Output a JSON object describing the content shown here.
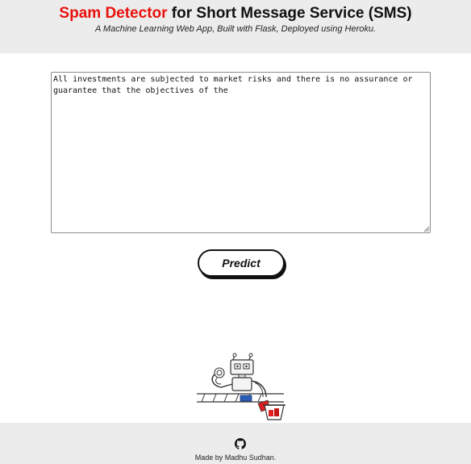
{
  "header": {
    "title_accent": "Spam Detector",
    "title_rest": " for Short Message Service (SMS)",
    "subtitle": "A Machine Learning Web App, Built with Flask, Deployed using Heroku."
  },
  "form": {
    "message_value": "All investments are subjected to market risks and there is no assurance or guarantee that the objectives of the",
    "predict_label": "Predict"
  },
  "illustration": {
    "icon": "robot-sorting-icon"
  },
  "footer": {
    "icon": "github-icon",
    "credit": "Made by Madhu Sudhan."
  }
}
